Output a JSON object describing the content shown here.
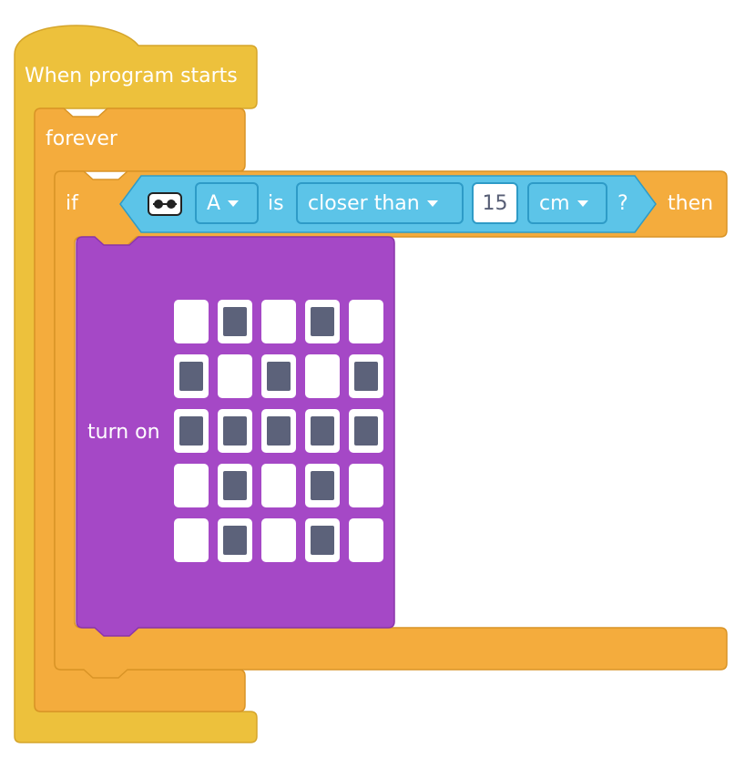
{
  "colors": {
    "events": "#EDC13C",
    "control": "#F4AC3D",
    "sensor": "#5CC4E8",
    "display": "#A548C6",
    "pixel_off": "#FFFFFF",
    "pixel_on": "#5C627A"
  },
  "hat_block": {
    "label": "When program starts"
  },
  "forever_block": {
    "label": "forever"
  },
  "if_block": {
    "label_if": "if",
    "label_then": "then"
  },
  "condition": {
    "icon": "distance-sensor-icon",
    "port": "A",
    "is_label": "is",
    "comparison": "closer than",
    "value": "15",
    "unit": "cm",
    "question": "?"
  },
  "light_block": {
    "label": "turn on",
    "matrix": [
      [
        0,
        1,
        0,
        1,
        0
      ],
      [
        1,
        0,
        1,
        0,
        1
      ],
      [
        1,
        1,
        1,
        1,
        1
      ],
      [
        0,
        1,
        0,
        1,
        0
      ],
      [
        0,
        1,
        0,
        1,
        0
      ]
    ]
  }
}
